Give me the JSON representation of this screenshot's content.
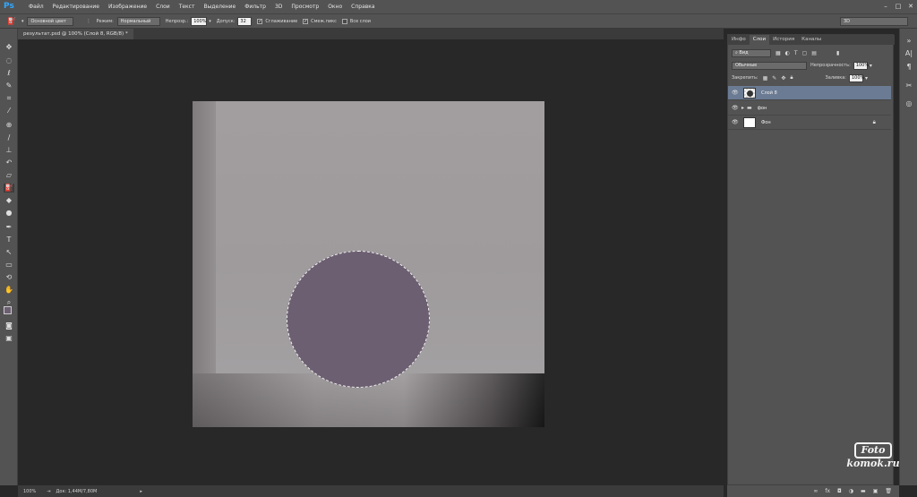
{
  "app": {
    "logo": "Ps"
  },
  "menu": [
    "Файл",
    "Редактирование",
    "Изображение",
    "Слои",
    "Текст",
    "Выделение",
    "Фильтр",
    "3D",
    "Просмотр",
    "Окно",
    "Справка"
  ],
  "window_controls": {
    "minimize": "–",
    "maximize": "□",
    "close": "✕"
  },
  "options": {
    "fill_source": "Основной цвет",
    "mode_label": "Режим:",
    "mode_value": "Нормальный",
    "opacity_label": "Непрозр.:",
    "opacity_value": "100%",
    "tolerance_label": "Допуск:",
    "tolerance_value": "32",
    "antialias_label": "Сглаживание",
    "contiguous_label": "Смеж.пикс",
    "all_layers_label": "Все слои",
    "preset_3d": "3D"
  },
  "document": {
    "tab_title": "результат.psd @ 100% (Слой 8, RGB/8) *"
  },
  "panel": {
    "tabs": [
      "Инфо",
      "Слои",
      "История",
      "Каналы"
    ],
    "active_tab": "Слои",
    "filter_kind": "Вид",
    "blend_mode": "Обычные",
    "opacity_label": "Непрозрачность:",
    "opacity_value": "100%",
    "lock_label": "Закрепить:",
    "fill_label": "Заливка:",
    "fill_value": "100%",
    "layers": [
      {
        "name": "Слой 8",
        "selected": true
      },
      {
        "name": "фон",
        "selected": false,
        "folder": true
      },
      {
        "name": "Фон",
        "selected": false,
        "locked": true
      }
    ]
  },
  "status": {
    "zoom": "100%",
    "doc_size": "Док: 1,44M/7,80M"
  },
  "watermark": {
    "line1": "Foto",
    "line2": "komok.ru"
  },
  "colors": {
    "selection_fill": "#6c5f71",
    "selected_layer": "#6b7b93",
    "ps_blue": "#31a8ff"
  }
}
